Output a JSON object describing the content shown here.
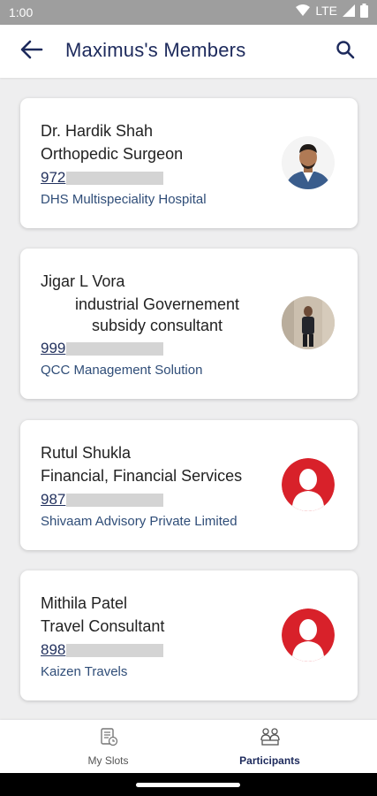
{
  "status_bar": {
    "time": "1:00",
    "network": "LTE",
    "icons": [
      "wifi-icon",
      "signal-icon",
      "battery-icon"
    ]
  },
  "header": {
    "title": "Maximus's Members",
    "back_icon": "back-arrow-icon",
    "search_icon": "search-icon"
  },
  "members": [
    {
      "name": "Dr. Hardik Shah",
      "role": "Orthopedic Surgeon",
      "phone_prefix": "972",
      "company": "DHS Multispeciality Hospital",
      "avatar": "photo"
    },
    {
      "name": "Jigar L Vora",
      "role_line1": "industrial Governement",
      "role_line2": "subsidy consultant",
      "phone_prefix": "999",
      "company": "QCC Management Solution",
      "avatar": "photo"
    },
    {
      "name": "Rutul Shukla",
      "role": "Financial, Financial Services",
      "phone_prefix": "987",
      "company": "Shivaam Advisory Private Limited",
      "avatar": "placeholder"
    },
    {
      "name": "Mithila Patel",
      "role": "Travel Consultant",
      "phone_prefix": "898",
      "company": "Kaizen Travels",
      "avatar": "placeholder"
    }
  ],
  "bottom_nav": {
    "items": [
      {
        "label": "My Slots",
        "icon": "slots-icon",
        "active": false
      },
      {
        "label": "Participants",
        "icon": "participants-icon",
        "active": true
      }
    ]
  },
  "colors": {
    "title": "#1d2a5c",
    "link": "#24335f",
    "company": "#2f4d78",
    "placeholder_avatar": "#d8212a",
    "background": "#eeeeef"
  }
}
